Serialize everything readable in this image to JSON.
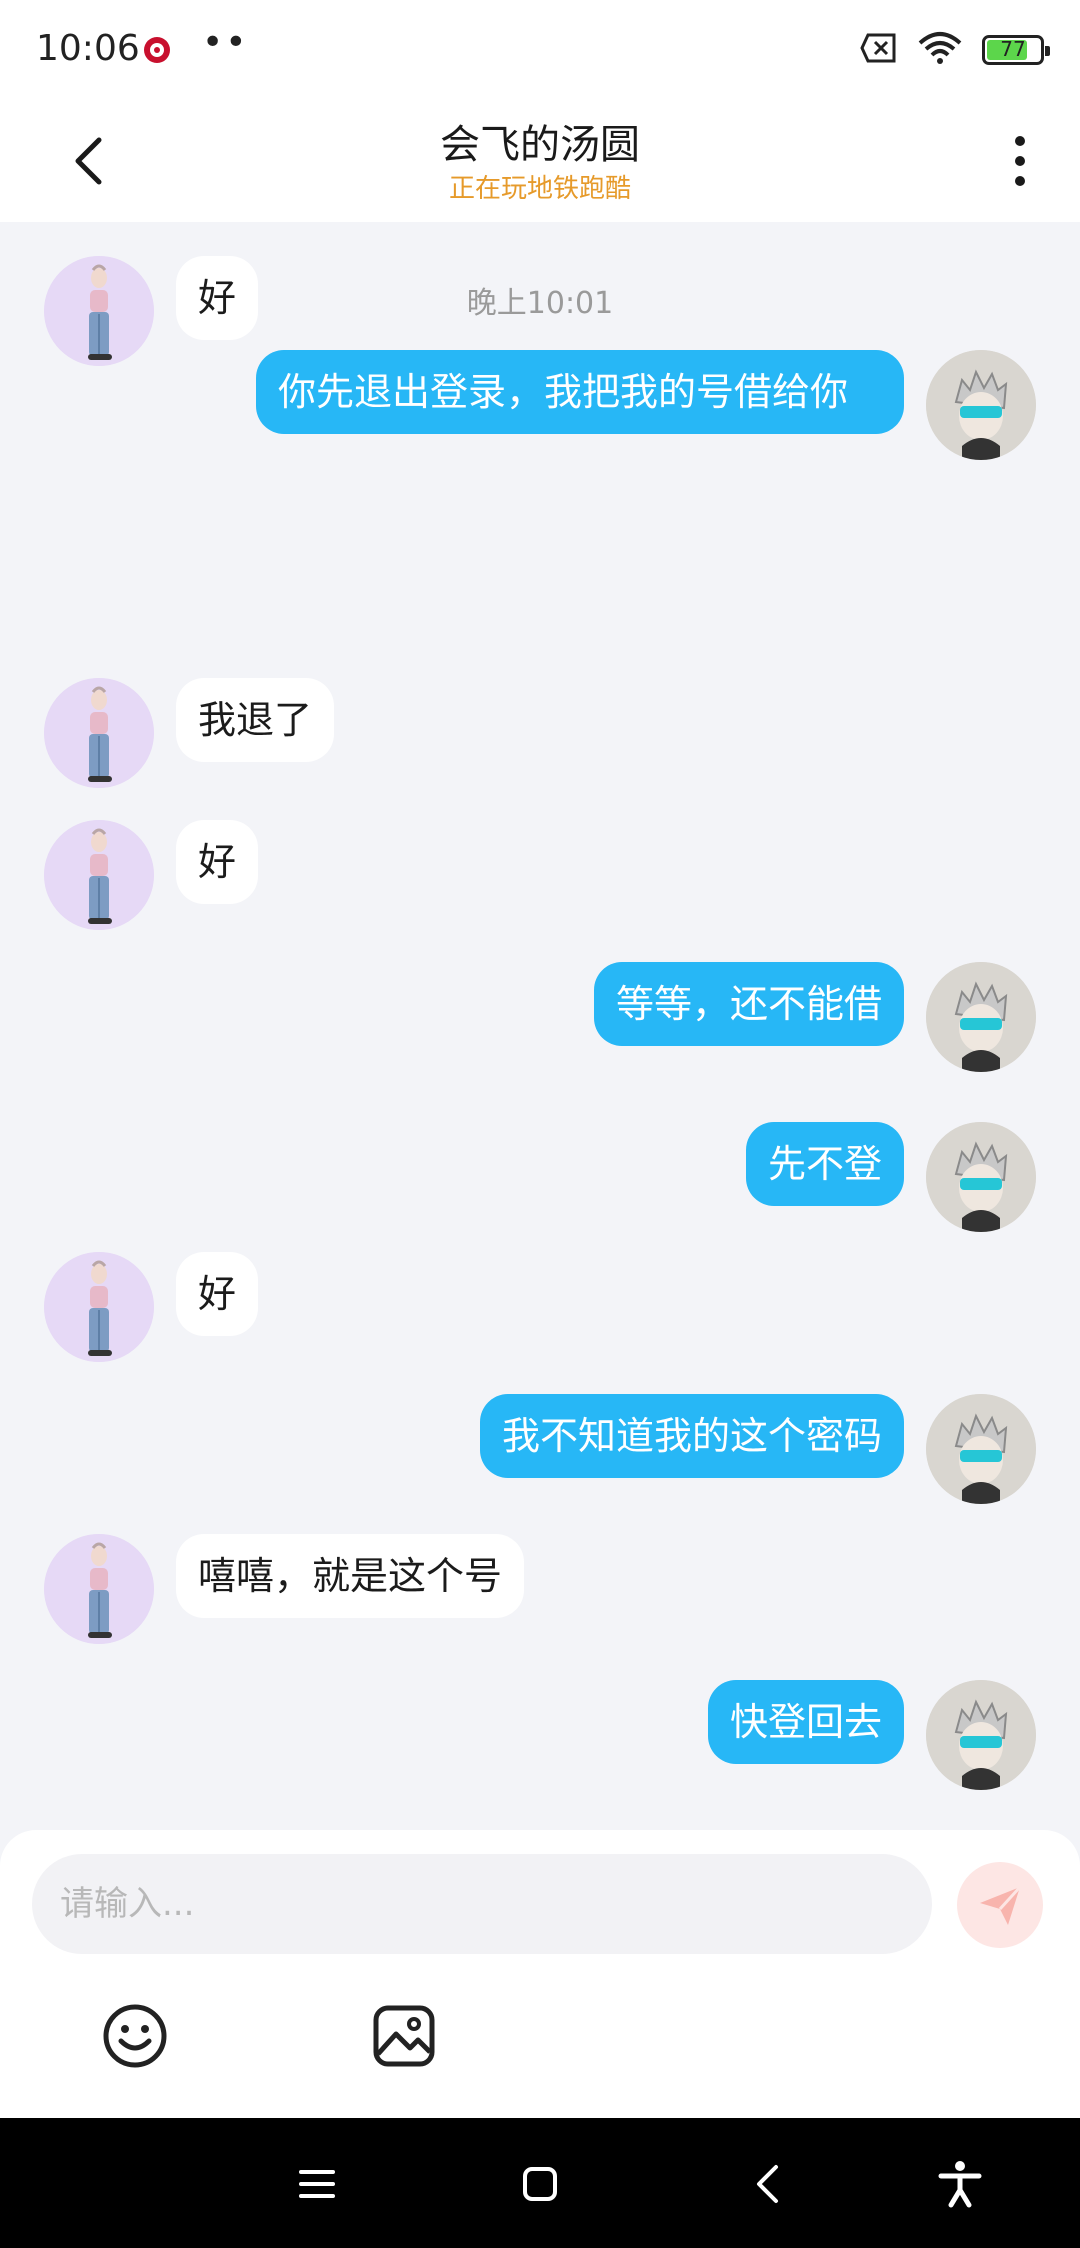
{
  "status": {
    "time": "10:06",
    "battery": "77",
    "battery_level": 0.77
  },
  "header": {
    "title": "会飞的汤圆",
    "subtitle": "正在玩地铁跑酷"
  },
  "chat": {
    "timestamp": "晚上10:01",
    "messages": [
      {
        "side": "left",
        "text": "好"
      },
      {
        "side": "right",
        "text": "你先退出登录，我把我的号借给你"
      },
      {
        "side": "left",
        "text": "我退了"
      },
      {
        "side": "left",
        "text": "好"
      },
      {
        "side": "right",
        "text": "等等，还不能借"
      },
      {
        "side": "right",
        "text": "先不登"
      },
      {
        "side": "left",
        "text": "好"
      },
      {
        "side": "right",
        "text": "我不知道我的这个密码"
      },
      {
        "side": "left",
        "text": "嘻嘻，就是这个号"
      },
      {
        "side": "right",
        "text": "快登回去"
      }
    ]
  },
  "composer": {
    "placeholder": "请输入..."
  },
  "icons": {
    "send": "send-icon",
    "emoji": "emoji-icon",
    "image": "image-icon",
    "back": "chevron-left-icon",
    "more": "more-vertical-icon"
  },
  "colors": {
    "bubble_self": "#27b7f6",
    "bubble_other": "#ffffff",
    "subtitle": "#e69a2a"
  }
}
